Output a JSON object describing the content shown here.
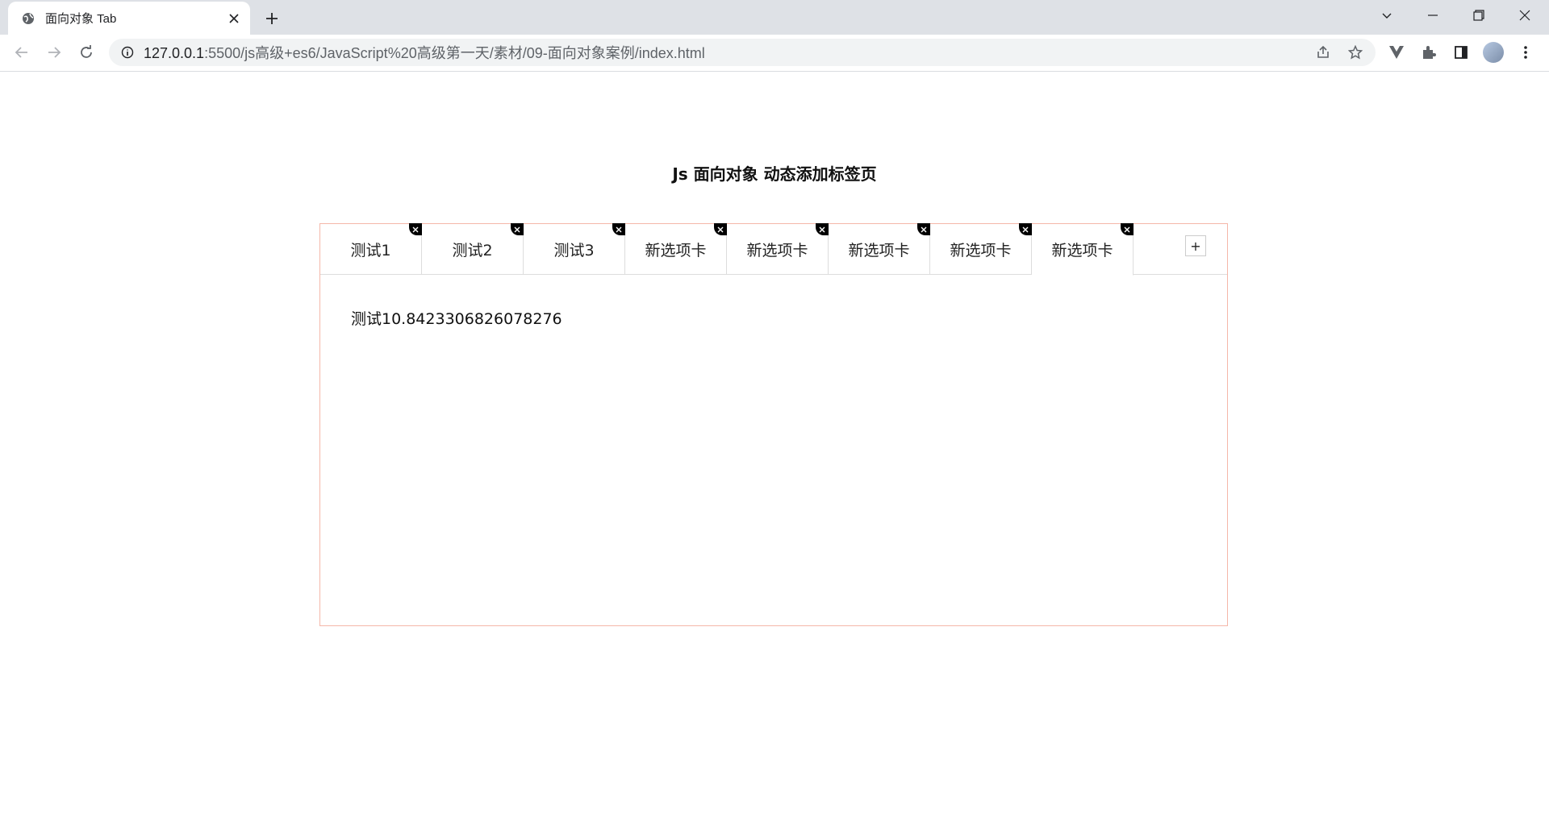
{
  "browser": {
    "tab_title": "面向对象 Tab",
    "url_host": "127.0.0.1",
    "url_path": ":5500/js高级+es6/JavaScript%20高级第一天/素材/09-面向对象案例/index.html"
  },
  "page": {
    "heading": "Js 面向对象 动态添加标签页",
    "tabs": [
      {
        "label": "测试1"
      },
      {
        "label": "测试2"
      },
      {
        "label": "测试3"
      },
      {
        "label": "新选项卡"
      },
      {
        "label": "新选项卡"
      },
      {
        "label": "新选项卡"
      },
      {
        "label": "新选项卡"
      },
      {
        "label": "新选项卡"
      }
    ],
    "active_tab_index": 7,
    "add_label": "+",
    "content_text": "测试10.8423306826078276"
  }
}
